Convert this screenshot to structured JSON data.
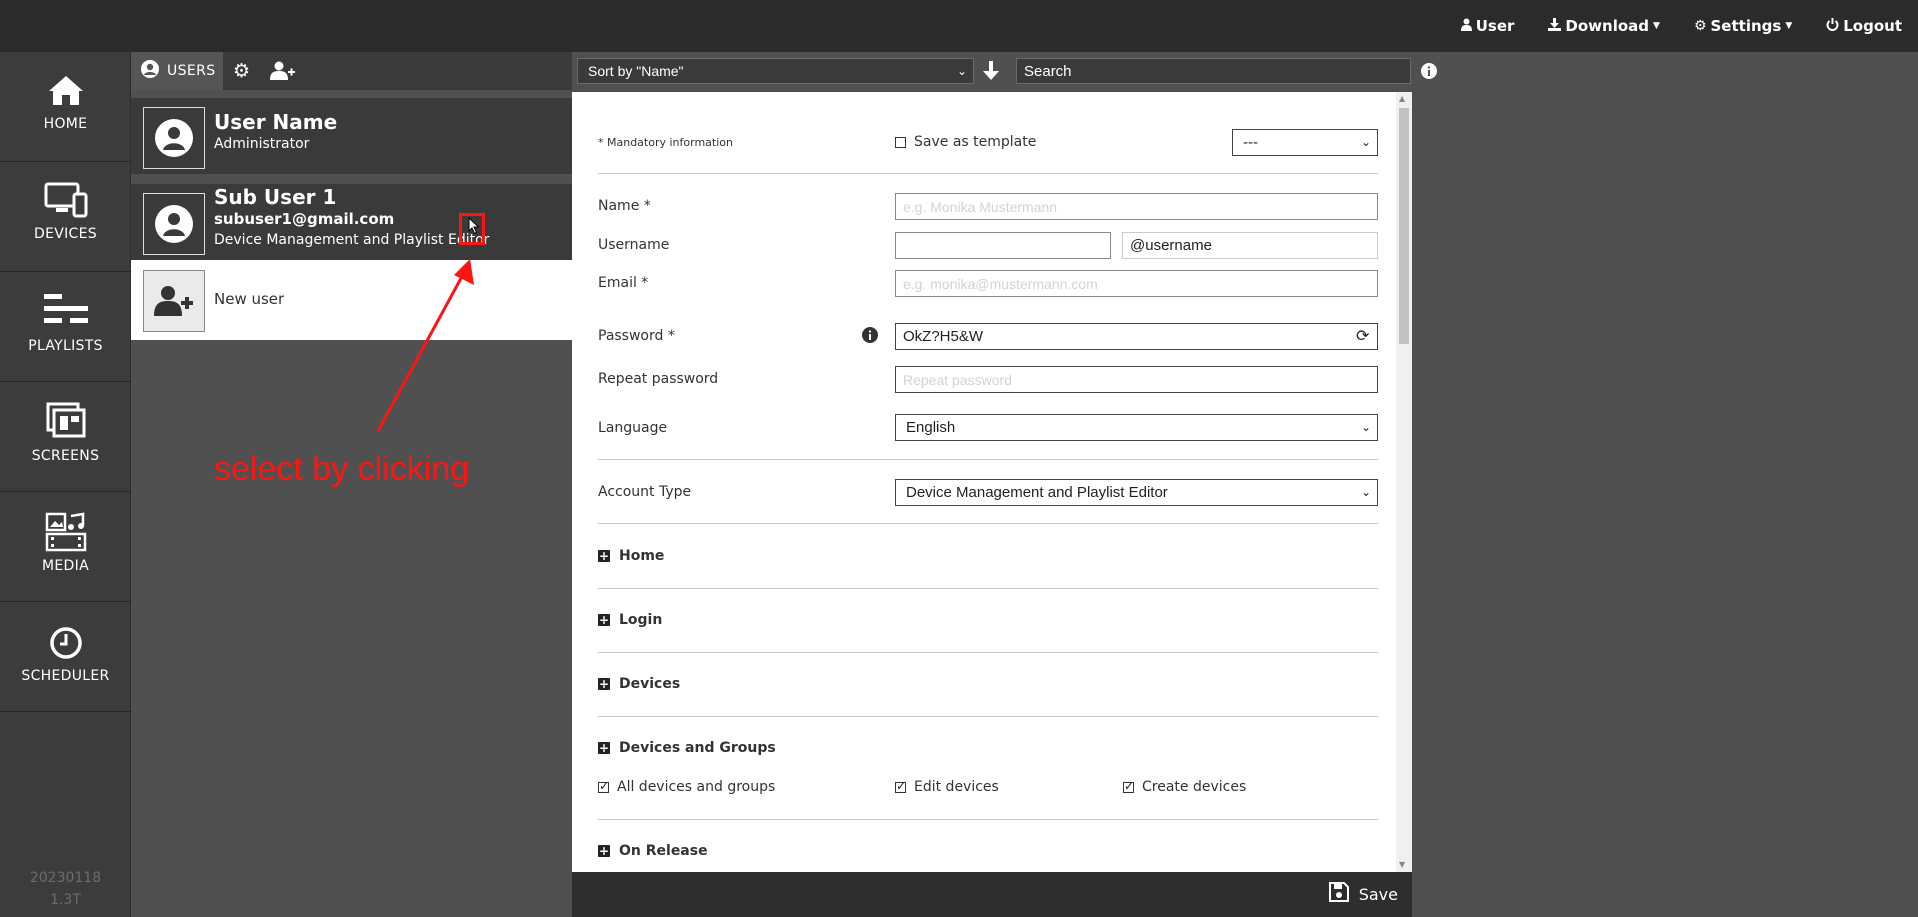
{
  "topnav": {
    "user": "User",
    "download": "Download",
    "settings": "Settings",
    "logout": "Logout"
  },
  "sidebar": {
    "items": [
      {
        "label": "HOME",
        "icon": "home-icon"
      },
      {
        "label": "DEVICES",
        "icon": "devices-icon"
      },
      {
        "label": "PLAYLISTS",
        "icon": "playlists-icon"
      },
      {
        "label": "SCREENS",
        "icon": "screens-icon"
      },
      {
        "label": "MEDIA",
        "icon": "media-icon"
      },
      {
        "label": "SCHEDULER",
        "icon": "scheduler-icon"
      }
    ],
    "version_line1": "20230118",
    "version_line2": "1.3T"
  },
  "users_panel": {
    "tab_label": "USERS",
    "users": [
      {
        "name": "User Name",
        "role": "Administrator"
      },
      {
        "name": "Sub User 1",
        "email": "subuser1@gmail.com",
        "role": "Device Management and Playlist Editor"
      }
    ],
    "new_user_label": "New user"
  },
  "toolbar": {
    "sort_value": "Sort by \"Name\"",
    "search_placeholder": "Search"
  },
  "form": {
    "mandatory_note": "* Mandatory information",
    "save_template_label": "Save as template",
    "template_select": "---",
    "name_label": "Name *",
    "name_placeholder": "e.g. Monika Mustermann",
    "username_label": "Username",
    "username_value": "",
    "username_suffix": "@username",
    "email_label": "Email *",
    "email_placeholder": "e.g. monika@mustermann.com",
    "password_label": "Password *",
    "password_value": "OkZ?H5&W",
    "repeat_password_label": "Repeat password",
    "repeat_password_placeholder": "Repeat password",
    "language_label": "Language",
    "language_value": "English",
    "account_type_label": "Account Type",
    "account_type_value": "Device Management and Playlist Editor",
    "sections": [
      "Home",
      "Login",
      "Devices",
      "Devices and Groups",
      "On Release"
    ],
    "devices_groups_checks": [
      {
        "label": "All devices and groups",
        "checked": true
      },
      {
        "label": "Edit devices",
        "checked": true
      },
      {
        "label": "Create devices",
        "checked": true
      }
    ]
  },
  "save_label": "Save",
  "annotation": {
    "text": "select by clicking",
    "color": "#ff1414"
  }
}
